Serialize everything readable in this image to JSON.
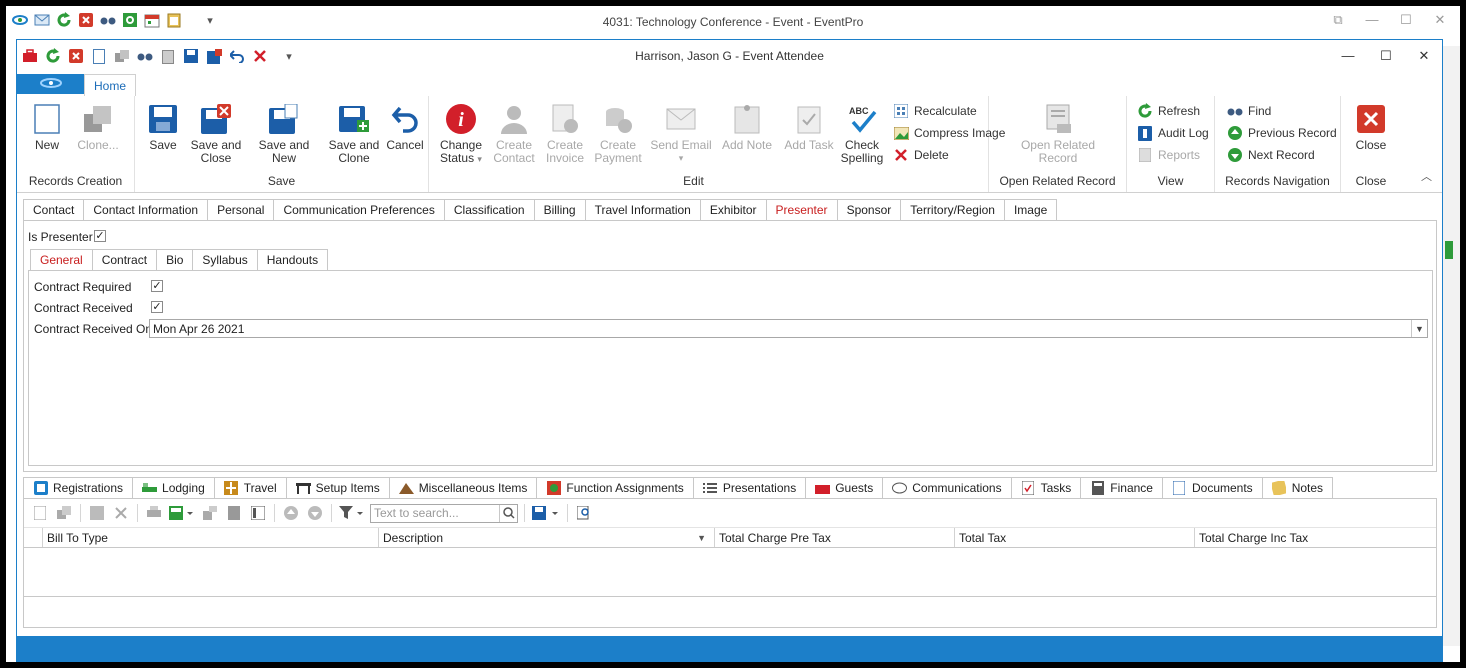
{
  "outer_window": {
    "title": "4031: Technology Conference - Event - EventPro"
  },
  "inner_window": {
    "title": "Harrison, Jason G - Event Attendee"
  },
  "ribbon": {
    "home_tab": "Home",
    "groups": {
      "records_creation": {
        "label": "Records Creation",
        "new": "New",
        "clone": "Clone..."
      },
      "save": {
        "label": "Save",
        "save": "Save",
        "save_close_1": "Save and",
        "save_close_2": "Close",
        "save_new": "Save and New",
        "save_clone_1": "Save and",
        "save_clone_2": "Clone",
        "cancel": "Cancel"
      },
      "edit": {
        "label": "Edit",
        "change_status_1": "Change",
        "change_status_2": "Status",
        "create_contact_1": "Create",
        "create_contact_2": "Contact",
        "create_invoice_1": "Create",
        "create_invoice_2": "Invoice",
        "create_payment_1": "Create",
        "create_payment_2": "Payment",
        "send_email": "Send Email",
        "add_note": "Add Note",
        "add_task": "Add Task",
        "check_spelling_1": "Check",
        "check_spelling_2": "Spelling",
        "recalculate": "Recalculate",
        "compress_image": "Compress Image",
        "delete": "Delete"
      },
      "open_related": {
        "label": "Open Related Record",
        "btn_1": "Open Related",
        "btn_2": "Record"
      },
      "view": {
        "label": "View",
        "refresh": "Refresh",
        "audit_log": "Audit Log",
        "reports": "Reports"
      },
      "records_nav": {
        "label": "Records Navigation",
        "find": "Find",
        "previous": "Previous Record",
        "next": "Next Record"
      },
      "close": {
        "label": "Close",
        "close": "Close"
      }
    }
  },
  "main_tabs": [
    "Contact",
    "Contact Information",
    "Personal",
    "Communication Preferences",
    "Classification",
    "Billing",
    "Travel Information",
    "Exhibitor",
    "Presenter",
    "Sponsor",
    "Territory/Region",
    "Image"
  ],
  "presenter": {
    "is_presenter_label": "Is Presenter",
    "sub_tabs": [
      "General",
      "Contract",
      "Bio",
      "Syllabus",
      "Handouts"
    ],
    "contract": {
      "required_label": "Contract Required",
      "received_label": "Contract Received",
      "received_on_label": "Contract Received On:",
      "received_on_value": "Mon Apr 26 2021"
    }
  },
  "bottom_tabs": [
    "Registrations",
    "Lodging",
    "Travel",
    "Setup Items",
    "Miscellaneous Items",
    "Function Assignments",
    "Presentations",
    "Guests",
    "Communications",
    "Tasks",
    "Finance",
    "Documents",
    "Notes"
  ],
  "grid": {
    "search_placeholder": "Text to search...",
    "columns": [
      "Bill To Type",
      "Description",
      "Total Charge Pre Tax",
      "Total Tax",
      "Total Charge Inc Tax"
    ]
  },
  "glyphs": {
    "check": "✓",
    "dropdown": "▼",
    "collapse": "︿",
    "minimize": "—",
    "maximize": "☐",
    "close": "✕",
    "restore": "⧉",
    "qa_more": "▾"
  },
  "colors": {
    "accent": "#1c7fc9",
    "active_tab": "#c81e1e"
  }
}
